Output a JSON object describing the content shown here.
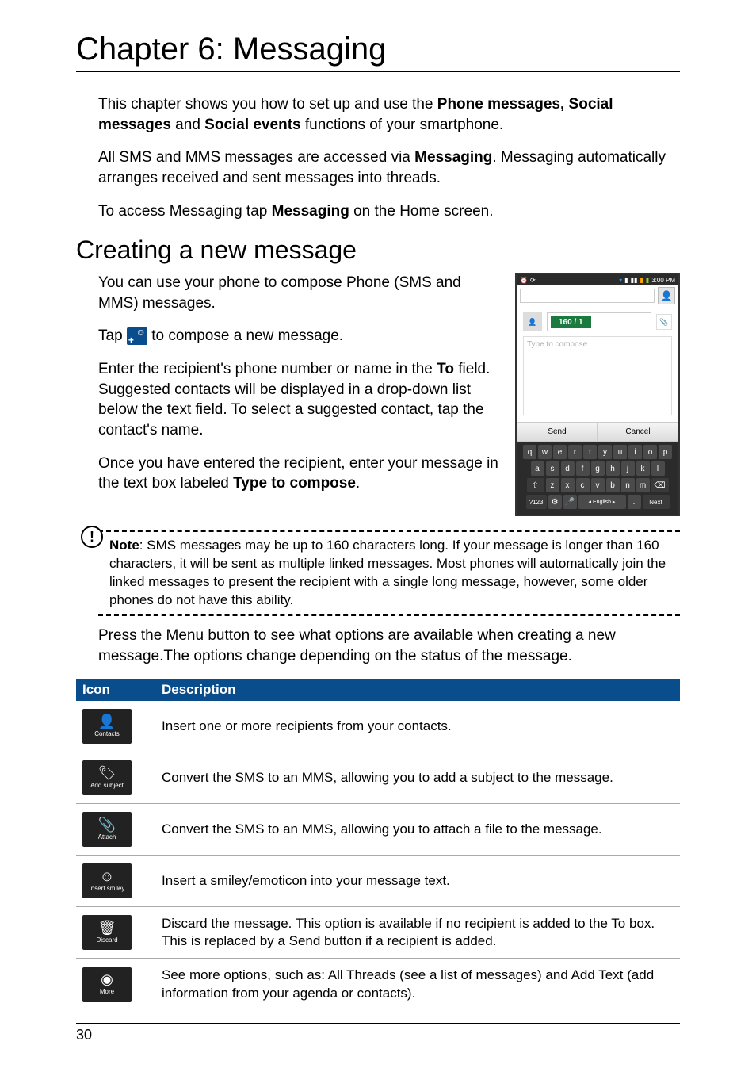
{
  "chapter_title": "Chapter 6: Messaging",
  "intro": {
    "p1_a": "This chapter shows you how to set up and use the ",
    "p1_b": "Phone messages, Social messages",
    "p1_c": " and ",
    "p1_d": "Social events",
    "p1_e": " functions of your smartphone.",
    "p2_a": "All SMS and MMS messages are accessed via ",
    "p2_b": "Messaging",
    "p2_c": ". Messaging automatically arranges received and sent messages into threads.",
    "p3_a": "To access Messaging tap ",
    "p3_b": "Messaging",
    "p3_c": " on the Home screen."
  },
  "section1": {
    "heading": "Creating a new message",
    "p1": "You can use your phone to compose Phone (SMS and MMS) messages.",
    "p2_a": "Tap ",
    "p2_b": " to compose a new message.",
    "p3_a": "Enter the recipient's phone number or name in the ",
    "p3_b": "To",
    "p3_c": " field. Suggested contacts will be displayed in a drop-down list below the text field. To select a suggested contact, tap the contact's name.",
    "p4_a": "Once you have entered the recipient, enter your message in the text box labeled ",
    "p4_b": "Type to compose",
    "p4_c": "."
  },
  "phone": {
    "time": "3:00 PM",
    "counter": "160 / 1",
    "placeholder": "Type to compose",
    "send": "Send",
    "cancel": "Cancel",
    "kb_r1": [
      "q",
      "w",
      "e",
      "r",
      "t",
      "y",
      "u",
      "i",
      "o",
      "p"
    ],
    "kb_r2": [
      "a",
      "s",
      "d",
      "f",
      "g",
      "h",
      "j",
      "k",
      "l"
    ],
    "kb_r3": [
      "z",
      "x",
      "c",
      "v",
      "b",
      "n",
      "m"
    ],
    "sym": "?123",
    "lang": "◂ English ▸",
    "next": "Next"
  },
  "note": {
    "label": "Note",
    "text": ": SMS messages may be up to 160 characters long. If your message is longer than 160 characters, it will be sent as multiple linked messages. Most phones will automatically join the linked messages to present the recipient with a single long message, however, some older phones do not have this ability."
  },
  "post_note": "Press the Menu button to see what options are available when creating a new message.The options change depending on the status of the message.",
  "table": {
    "headers": {
      "icon": "Icon",
      "desc": "Description"
    },
    "rows": [
      {
        "glyph": "👤",
        "icon_label": "Contacts",
        "name": "contacts-icon",
        "desc": "Insert one or more recipients from your contacts."
      },
      {
        "glyph": "🏷",
        "icon_label": "Add subject",
        "name": "add-subject-icon",
        "desc": "Convert the SMS to an MMS, allowing you to add a subject to the message."
      },
      {
        "glyph": "📎",
        "icon_label": "Attach",
        "name": "attach-icon",
        "desc": "Convert the SMS to an MMS, allowing you to attach a file to the message."
      },
      {
        "glyph": "☺",
        "icon_label": "Insert smiley",
        "name": "insert-smiley-icon",
        "desc": "Insert a smiley/emoticon into your message text."
      },
      {
        "glyph": "🗑",
        "icon_label": "Discard",
        "name": "discard-icon",
        "desc": "Discard the message. This option is available if no recipient is added to the To box. This is replaced by a Send button if a recipient is added."
      },
      {
        "glyph": "◉",
        "icon_label": "More",
        "name": "more-icon",
        "desc": "See more options, such as: All Threads (see a list of messages) and Add Text (add information from your agenda or contacts)."
      }
    ]
  },
  "page_number": "30"
}
